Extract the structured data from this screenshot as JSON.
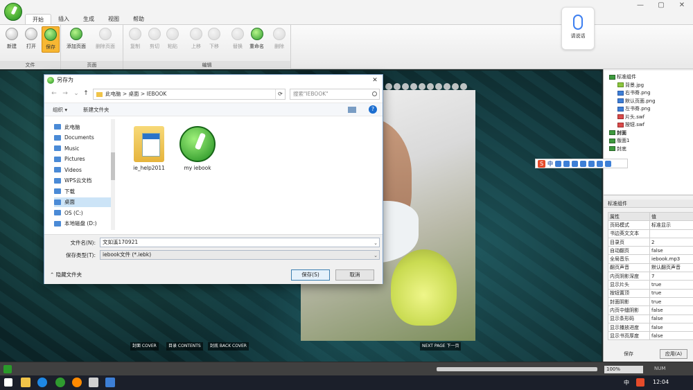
{
  "ribbon": {
    "tabs": [
      "开始",
      "插入",
      "生成",
      "视图",
      "帮助"
    ],
    "active_tab": 0,
    "groups": [
      {
        "title": "文件",
        "buttons": [
          "新建",
          "打开",
          "保存"
        ]
      },
      {
        "title": "页面",
        "buttons": [
          "添加页面",
          "删除页面"
        ]
      },
      {
        "title": "编辑",
        "buttons": [
          "复制",
          "剪切",
          "粘贴",
          "上移",
          "下移",
          "替换",
          "重命名",
          "删除"
        ]
      }
    ],
    "voice_label": "请说话"
  },
  "canvas": {
    "bottom_nav": [
      "封面 COVER",
      "目录 CONTENTS",
      "封底 BACK COVER",
      "NEXT PAGE 下一页"
    ]
  },
  "panel": {
    "tree": [
      {
        "label": "标准组件",
        "level": 0,
        "kind": "page",
        "bold": false
      },
      {
        "label": "背景.jpg",
        "level": 1,
        "kind": "jpg",
        "bold": false
      },
      {
        "label": "右书脊.png",
        "level": 1,
        "kind": "png",
        "bold": false
      },
      {
        "label": "默认页面.png",
        "level": 1,
        "kind": "png",
        "bold": false
      },
      {
        "label": "左书脊.png",
        "level": 1,
        "kind": "png",
        "bold": false
      },
      {
        "label": "片头.swf",
        "level": 1,
        "kind": "swf",
        "bold": false
      },
      {
        "label": "按钮.swf",
        "level": 1,
        "kind": "swf",
        "bold": false
      },
      {
        "label": "封面",
        "level": 0,
        "kind": "page",
        "bold": true
      },
      {
        "label": "版面1",
        "level": 0,
        "kind": "page",
        "bold": false
      },
      {
        "label": "封底",
        "level": 0,
        "kind": "page",
        "bold": false
      }
    ],
    "props_title": "标准组件",
    "props_header": [
      "属性",
      "值"
    ],
    "props": [
      [
        "页码模式",
        "标准显示"
      ],
      [
        "书边英文文本",
        ""
      ],
      [
        "目录页",
        "2"
      ],
      [
        "自动翻页",
        "false"
      ],
      [
        "全局音乐",
        "iebook.mp3"
      ],
      [
        "翻页声音",
        "默认翻页声音"
      ],
      [
        "内页阴影深度",
        "7"
      ],
      [
        "显示片头",
        "true"
      ],
      [
        "按钮置顶",
        "true"
      ],
      [
        "封面阴影",
        "true"
      ],
      [
        "内页中缝阴影",
        "false"
      ],
      [
        "显示条形码",
        "false"
      ],
      [
        "显示播放进度",
        "false"
      ],
      [
        "显示书页厚度",
        "false"
      ]
    ],
    "save_label": "保存",
    "apply_label": "应用(A)"
  },
  "status": {
    "zoom": "100%",
    "num": "NUM"
  },
  "taskbar": {
    "ime": "中",
    "clock": "12:04"
  },
  "dialog": {
    "title": "另存为",
    "breadcrumb": "此电脑  >  桌面  >  IEBOOK",
    "search_placeholder": "搜索\"IEBOOK\"",
    "organize": "组织 ▾",
    "new_folder": "新建文件夹",
    "nav_items": [
      "此电脑",
      "Documents",
      "Music",
      "Pictures",
      "Videos",
      "WPS云文档",
      "下载",
      "桌面",
      "OS (C:)",
      "本地磁盘 (D:)"
    ],
    "selected_nav": 7,
    "files": [
      {
        "name": "ie_help2011",
        "kind": "folder"
      },
      {
        "name": "my iebook",
        "kind": "app"
      }
    ],
    "filename_label": "文件名(N):",
    "filename_value": "文如溪170921",
    "filetype_label": "保存类型(T):",
    "filetype_value": "iebook文件 (*.iebk)",
    "hide_folders": "隐藏文件夹",
    "save_button": "保存(S)",
    "cancel_button": "取消"
  }
}
